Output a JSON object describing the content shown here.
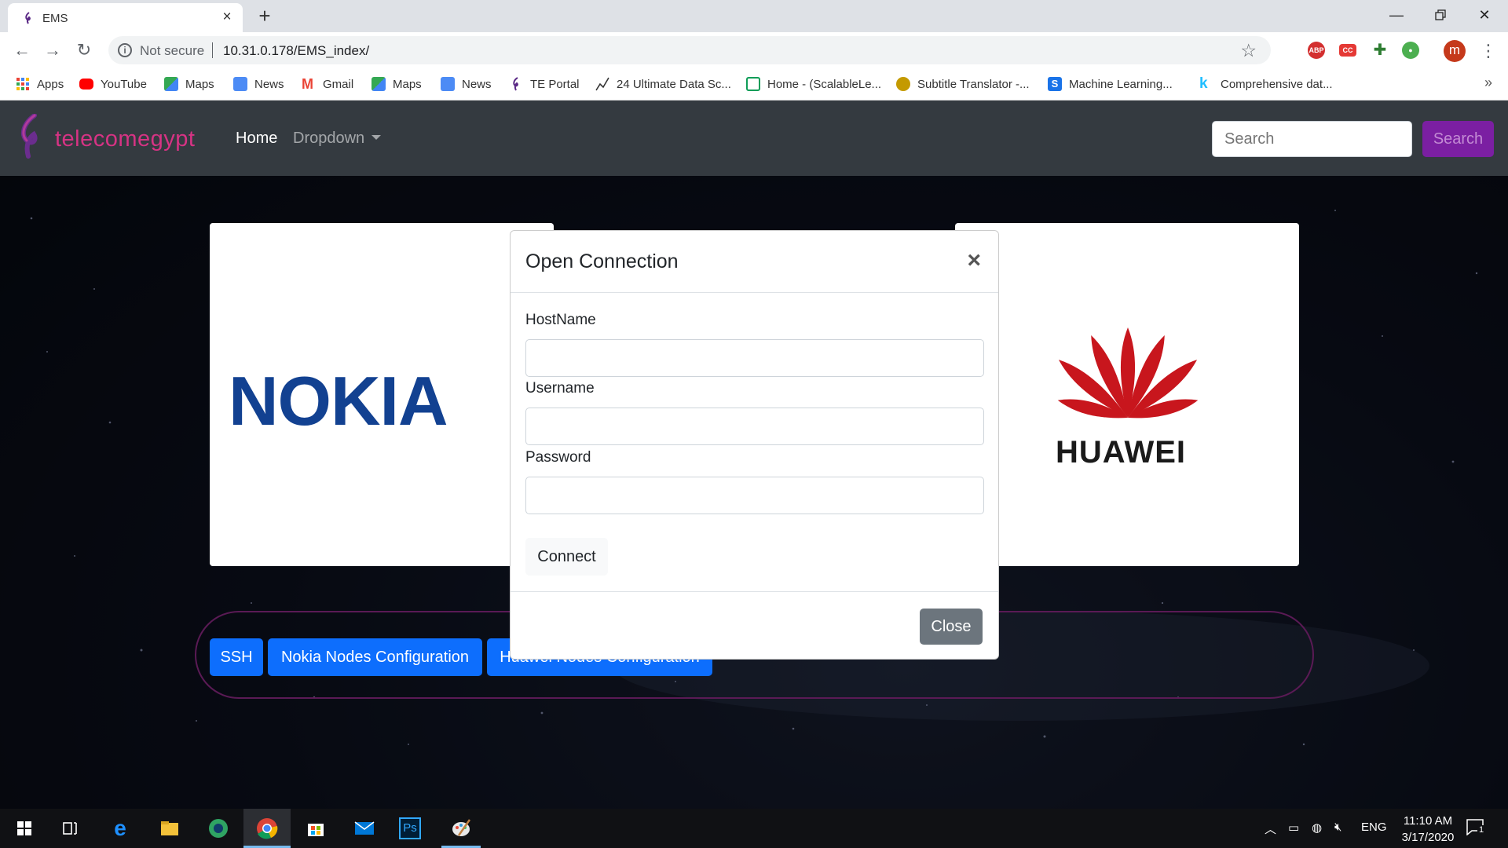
{
  "browser": {
    "tab_title": "EMS",
    "address_security": "Not secure",
    "address_url": "10.31.0.178/EMS_index/",
    "avatar_letter": "m",
    "bookmarks": [
      {
        "label": "Apps",
        "icon": "apps-grid-icon",
        "color": "#4285f4"
      },
      {
        "label": "YouTube",
        "icon": "youtube-icon",
        "color": "#ff0000"
      },
      {
        "label": "Maps",
        "icon": "maps-icon",
        "color": "#34a853"
      },
      {
        "label": "News",
        "icon": "news-icon",
        "color": "#4c8bf5"
      },
      {
        "label": "Gmail",
        "icon": "gmail-icon",
        "color": "#ea4335"
      },
      {
        "label": "Maps",
        "icon": "maps-icon",
        "color": "#34a853"
      },
      {
        "label": "News",
        "icon": "news-icon",
        "color": "#4c8bf5"
      },
      {
        "label": "TE Portal",
        "icon": "te-portal-icon",
        "color": "#5b2a86"
      },
      {
        "label": "24 Ultimate Data Sc...",
        "icon": "chart-line-icon",
        "color": "#333333"
      },
      {
        "label": "Home - (ScalableLe...",
        "icon": "play-icon",
        "color": "#0f9d58"
      },
      {
        "label": "Subtitle Translator -...",
        "icon": "subtitle-icon",
        "color": "#c49a00"
      },
      {
        "label": "Machine Learning...",
        "icon": "s-icon",
        "color": "#1a73e8"
      },
      {
        "label": "Comprehensive dat...",
        "icon": "k-icon",
        "color": "#20beff"
      }
    ]
  },
  "site": {
    "brand": "telecomegypt",
    "nav_home": "Home",
    "nav_dropdown": "Dropdown",
    "search_placeholder": "Search",
    "search_button": "Search",
    "nokia_logo_text": "NOKIA",
    "huawei_logo_text": "HUAWEI",
    "buttons": [
      "SSH",
      "Nokia Nodes Configuration",
      "Huawei Nodes Configuration"
    ]
  },
  "modal": {
    "title": "Open Connection",
    "close_x": "×",
    "host_label": "HostName",
    "user_label": "Username",
    "pass_label": "Password",
    "host_value": "",
    "user_value": "",
    "pass_value": "",
    "connect": "Connect",
    "close": "Close"
  },
  "taskbar": {
    "language": "ENG",
    "time": "11:10 AM",
    "date": "3/17/2020",
    "notification_count": "1"
  },
  "colors": {
    "brand_magenta": "#d63384",
    "nokia_blue": "#124191",
    "huawei_red": "#c8161d",
    "primary_blue": "#0d6efd",
    "search_purple": "#7b1fa2"
  }
}
